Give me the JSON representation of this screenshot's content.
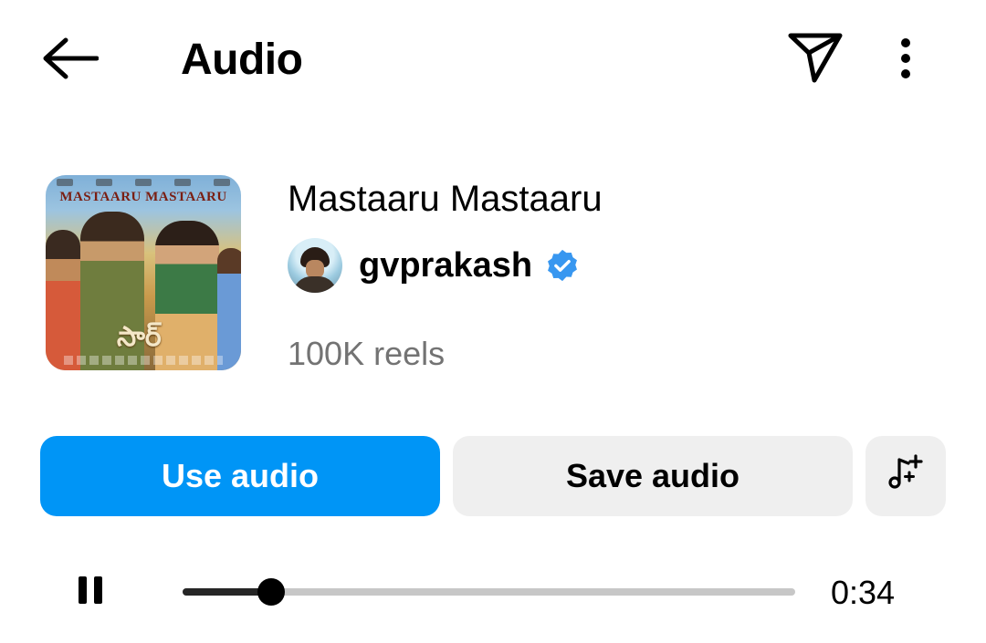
{
  "header": {
    "title": "Audio",
    "back_icon": "arrow-left-icon",
    "share_icon": "paper-plane-icon",
    "more_icon": "more-vertical-icon"
  },
  "audio": {
    "cover_text": "MASTAARU MASTAARU",
    "cover_telugu": "సార్",
    "title": "Mastaaru Mastaaru",
    "artist": "gvprakash",
    "verified": true,
    "reels_count": "100K reels"
  },
  "actions": {
    "use_label": "Use audio",
    "save_label": "Save audio",
    "music_icon": "music-note-sparkle-icon"
  },
  "player": {
    "state_icon": "pause-icon",
    "progress": 0.145,
    "time": "0:34"
  },
  "colors": {
    "primary": "#0095f6",
    "secondary_bg": "#efefef",
    "muted_text": "#737373",
    "verified_badge": "#3897f0"
  }
}
